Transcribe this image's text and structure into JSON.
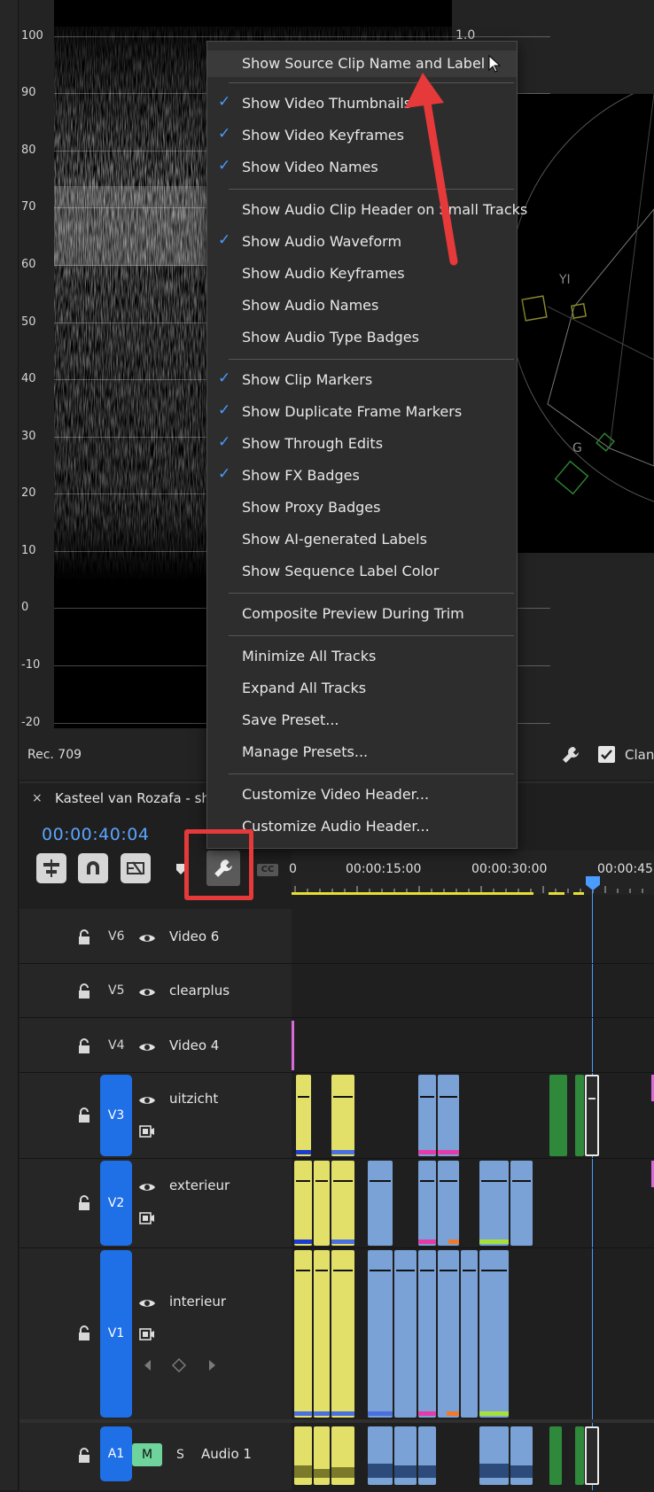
{
  "scopes": {
    "waveform_ticks": [
      "100",
      "90",
      "80",
      "70",
      "60",
      "50",
      "40",
      "30",
      "20",
      "10",
      "0",
      "-10",
      "-20"
    ],
    "top_right_value": "1.0",
    "color_space": "Rec. 709",
    "vectorscope_labels": [
      "YI",
      "G"
    ],
    "clamp_label": "Clan"
  },
  "context_menu": {
    "items": [
      {
        "label": "Show Source Clip Name and Label",
        "checked": false,
        "highlighted": true
      },
      {
        "label": "Show Video Thumbnails",
        "checked": true
      },
      {
        "label": "Show Video Keyframes",
        "checked": true
      },
      {
        "label": "Show Video Names",
        "checked": true
      },
      {
        "label": "Show Audio Clip Header on Small Tracks",
        "checked": false
      },
      {
        "label": "Show Audio Waveform",
        "checked": true
      },
      {
        "label": "Show Audio Keyframes",
        "checked": false
      },
      {
        "label": "Show Audio Names",
        "checked": false
      },
      {
        "label": "Show Audio Type Badges",
        "checked": false
      },
      {
        "label": "Show Clip Markers",
        "checked": true
      },
      {
        "label": "Show Duplicate Frame Markers",
        "checked": true
      },
      {
        "label": "Show Through Edits",
        "checked": true
      },
      {
        "label": "Show FX Badges",
        "checked": true
      },
      {
        "label": "Show Proxy Badges",
        "checked": false
      },
      {
        "label": "Show AI-generated Labels",
        "checked": false
      },
      {
        "label": "Show Sequence Label Color",
        "checked": false
      },
      {
        "label": "Composite Preview During Trim",
        "checked": false
      },
      {
        "label": "Minimize All Tracks",
        "checked": false
      },
      {
        "label": "Expand All Tracks",
        "checked": false
      },
      {
        "label": "Save Preset...",
        "checked": false
      },
      {
        "label": "Manage Presets...",
        "checked": false
      },
      {
        "label": "Customize Video Header...",
        "checked": false
      },
      {
        "label": "Customize Audio Header...",
        "checked": false
      }
    ],
    "check_glyph": "✓"
  },
  "sequence": {
    "close_glyph": "×",
    "title": "Kasteel van Rozafa - sh",
    "timecode": "00:00:40:04",
    "cc_badge": "CC",
    "ruler": [
      "0",
      "00:00:15:00",
      "00:00:30:00",
      "00:00:45"
    ]
  },
  "tracks": {
    "v6": {
      "id": "V6",
      "name": "Video 6"
    },
    "v5": {
      "id": "V5",
      "name": "clearplus"
    },
    "v4": {
      "id": "V4",
      "name": "Video 4"
    },
    "v3": {
      "id": "V3",
      "name": "uitzicht"
    },
    "v2": {
      "id": "V2",
      "name": "exterieur"
    },
    "v1": {
      "id": "V1",
      "name": "interieur"
    },
    "a1": {
      "id": "A1",
      "name": "Audio 1",
      "mute": "M",
      "solo": "S"
    }
  },
  "colors": {
    "accent_blue": "#1f6fe6",
    "timecode": "#5aa5ff",
    "annotation_red": "#e5393a",
    "clip_yellow": "#e3e06a",
    "clip_blue": "#7aa2d6"
  }
}
